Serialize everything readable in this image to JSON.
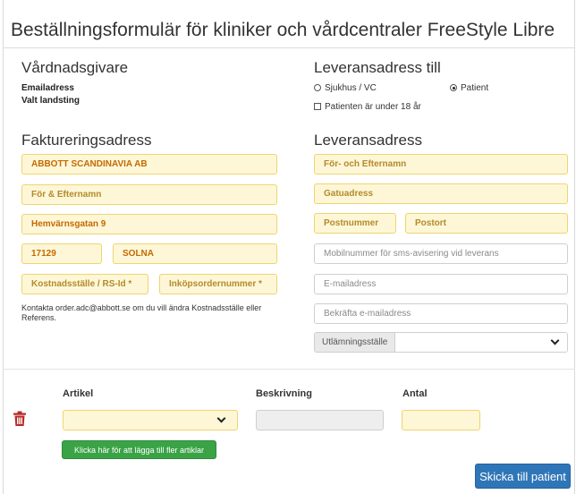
{
  "page": {
    "title": "Beställningsformulär för kliniker och vårdcentraler FreeStyle Libre"
  },
  "caregiver": {
    "heading": "Vårdnadsgivare",
    "email_label": "Emailadress",
    "region_label": "Valt landsting"
  },
  "delivery_to": {
    "heading": "Leveransadress till",
    "option_hospital": "Sjukhus / VC",
    "option_patient": "Patient",
    "selected": "Patient",
    "under18_label": "Patienten är under 18 år",
    "under18_checked": false
  },
  "billing": {
    "heading": "Faktureringsadress",
    "company": "ABBOTT SCANDINAVIA AB",
    "name_placeholder": "För & Efternamn",
    "street": "Hemvärnsgatan 9",
    "postcode": "17129",
    "city": "SOLNA",
    "cost_center_placeholder": "Kostnadsställe / RS-Id *",
    "po_placeholder": "Inköpsordernummer *",
    "contact_note": "Kontakta order.adc@abbott.se om du vill ändra Kostnadsställe eller Referens."
  },
  "delivery_address": {
    "heading": "Leveransadress",
    "name_placeholder": "För- och Efternamn",
    "street_placeholder": "Gatuadress",
    "postcode_placeholder": "Postnummer",
    "city_placeholder": "Postort",
    "mobile_placeholder": "Mobilnummer för sms-avisering vid leverans",
    "email_placeholder": "E-mailadress",
    "email_confirm_placeholder": "Bekräfta e-mailadress",
    "pickup_label": "Utlämningsställe",
    "pickup_value": ""
  },
  "articles": {
    "col_article": "Artikel",
    "col_description": "Beskrivning",
    "col_quantity": "Antal",
    "rows": [
      {
        "article": "",
        "description": "",
        "quantity": ""
      }
    ],
    "add_button": "Klicka här för att lägga till fler artiklar"
  },
  "submit_button": "Skicka till patient",
  "colors": {
    "field_required_bg": "#fdf7d8",
    "field_required_border": "#f0d46c",
    "field_text": "#c56a00",
    "trash_icon": "#b52b27",
    "add_button": "#3aa346",
    "submit_button": "#2f76b8"
  }
}
